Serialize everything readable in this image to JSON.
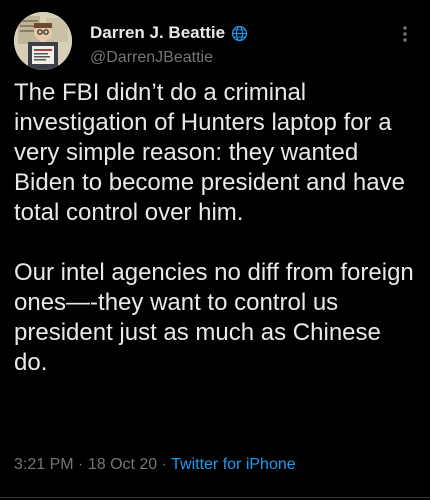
{
  "author": {
    "display_name": "Darren J. Beattie",
    "handle": "@DarrenJBeattie",
    "avatar": "cartoon-avatar",
    "verified_icon": "globe-icon"
  },
  "tweet": {
    "text": "The FBI didn’t do a criminal investigation of Hunters laptop for a very simple reason: they wanted Biden to become president and have total control over him.\n\nOur intel agencies no diff from foreign ones—-they want to control us president just as much as Chinese do.",
    "time": "3:21 PM",
    "separator": "·",
    "date": "18 Oct 20",
    "source": "Twitter for iPhone"
  },
  "menu": {
    "icon": "more-vertical-icon"
  },
  "colors": {
    "background": "#000000",
    "text": "#e7e9ea",
    "secondary": "#71767b",
    "link": "#1d9bf0",
    "divider": "#2f3336"
  }
}
